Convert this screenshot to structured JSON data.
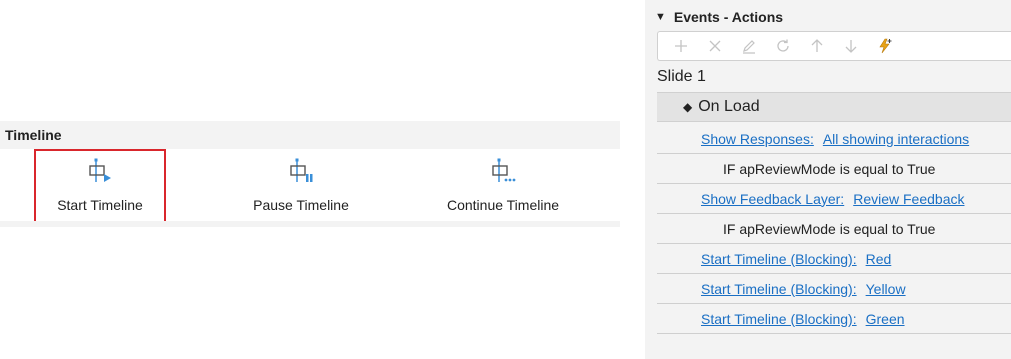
{
  "timeline": {
    "group_title": "Timeline",
    "buttons": [
      {
        "label": "Start Timeline",
        "icon": "timeline-start-icon",
        "selected": true
      },
      {
        "label": "Pause Timeline",
        "icon": "timeline-pause-icon",
        "selected": false
      },
      {
        "label": "Continue Timeline",
        "icon": "timeline-continue-icon",
        "selected": false
      }
    ]
  },
  "events_panel": {
    "title": "Events - Actions",
    "toolbar": [
      {
        "icon": "plus-icon",
        "enabled": false
      },
      {
        "icon": "close-icon",
        "enabled": false
      },
      {
        "icon": "edit-icon",
        "enabled": false
      },
      {
        "icon": "refresh-icon",
        "enabled": false
      },
      {
        "icon": "arrow-up-icon",
        "enabled": false
      },
      {
        "icon": "arrow-down-icon",
        "enabled": false
      },
      {
        "icon": "add-event-icon",
        "enabled": true
      }
    ],
    "slide_title": "Slide 1",
    "event_name": "On Load",
    "actions": [
      {
        "type": "action",
        "label": "Show Responses:",
        "value": "All showing interactions"
      },
      {
        "type": "condition",
        "text": "IF apReviewMode is equal to True"
      },
      {
        "type": "action",
        "label": "Show Feedback Layer:",
        "value": "Review Feedback"
      },
      {
        "type": "condition",
        "text": "IF apReviewMode is equal to True"
      },
      {
        "type": "action",
        "label": "Start Timeline (Blocking):",
        "value": "Red"
      },
      {
        "type": "action",
        "label": "Start Timeline (Blocking):",
        "value": "Yellow"
      },
      {
        "type": "action",
        "label": "Start Timeline (Blocking):",
        "value": "Green"
      }
    ]
  },
  "colors": {
    "link": "#1a6fc4",
    "icon_blue": "#3a8fd8",
    "selection_border": "#d9262c",
    "panel_bg": "#f3f3f3",
    "event_row_bg": "#e3e3e3",
    "accent_orange": "#e8a317"
  }
}
